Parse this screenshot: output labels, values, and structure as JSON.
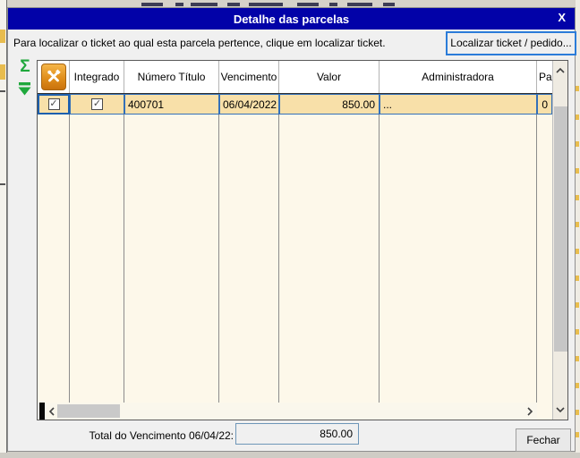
{
  "window": {
    "title": "Detalhe das parcelas",
    "close_glyph": "X"
  },
  "header": {
    "instruction": "Para localizar o ticket ao qual esta parcela pertence, clique em localizar ticket.",
    "locate_button_label": "Localizar ticket / pedido..."
  },
  "side_toolbar": {
    "sum_glyph": "Σ"
  },
  "grid": {
    "columns": [
      "",
      "Integrado",
      "Número Título",
      "Vencimento",
      "Valor",
      "Administradora",
      "Parc"
    ],
    "rows": [
      {
        "selected": true,
        "row_checked": true,
        "integrado_checked": true,
        "numero_titulo": "400701",
        "vencimento": "06/04/2022",
        "valor": "850.00",
        "administradora": "...",
        "parc": "0"
      }
    ]
  },
  "icons": {
    "check_glyph": "✓"
  },
  "footer": {
    "total_label": "Total do Vencimento 06/04/22:",
    "total_value": "850.00",
    "close_button_label": "Fechar"
  },
  "colors": {
    "titlebar_bg": "#0202A8",
    "dialog_bg": "#F0F0F0",
    "grid_bg": "#FDF8EA",
    "selected_row_bg": "#F8E0A9",
    "selection_border": "#3470B8",
    "focused_button_border": "#2B7CD9",
    "green_icon": "#1FA83C",
    "tool_button_orange": "#E08E1C"
  }
}
